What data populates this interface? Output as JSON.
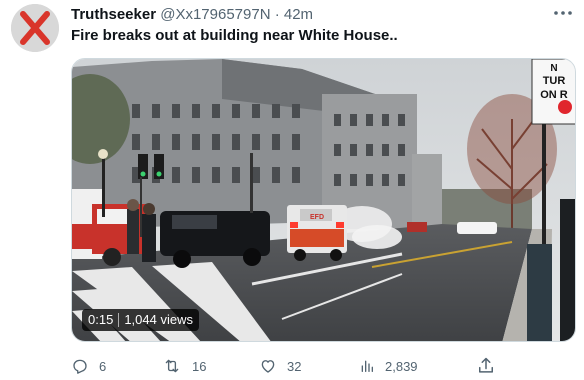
{
  "post": {
    "author_name": "Truthseeker",
    "author_handle": "@Xx17965797N",
    "separator": "·",
    "time": "42m",
    "text": "Fire breaks out at building near White House..",
    "more_icon": "more-horizontal-icon"
  },
  "media": {
    "duration": "0:15",
    "views": "1,044 views",
    "sign_text_line1": "TUR",
    "sign_text_line2": "ON R",
    "sign_text_line0": "N",
    "truck_label": "EFD"
  },
  "actions": {
    "replies": "6",
    "reposts": "16",
    "likes": "32",
    "views": "2,839"
  },
  "colors": {
    "text_primary": "#0f1419",
    "text_secondary": "#536471",
    "avatar_x": "#d9352b"
  }
}
